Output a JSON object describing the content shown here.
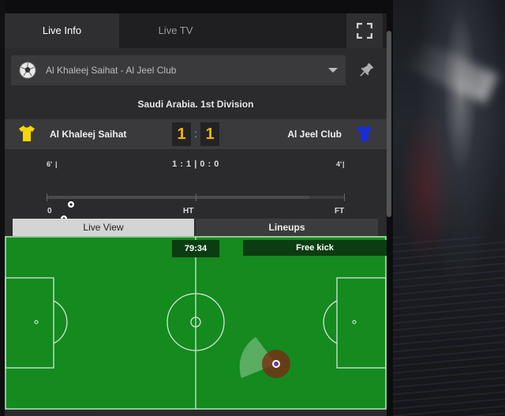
{
  "tabs": [
    {
      "label": "Live Info",
      "active": true
    },
    {
      "label": "Live TV",
      "active": false
    }
  ],
  "icons": {
    "fullscreen": "fullscreen-icon",
    "soccer_ball": "soccer-ball-icon",
    "pin": "pin-icon",
    "home_shirt": "shirt-icon",
    "away_shirt": "shirt-icon"
  },
  "match_select": {
    "value": "Al Khaleej Saihat - Al Jeel Club"
  },
  "league": "Saudi Arabia. 1st Division",
  "score": {
    "home_team": "Al Khaleej Saihat",
    "away_team": "Al Jeel Club",
    "home_goals": "1",
    "away_goals": "1",
    "separator": ":",
    "home_shirt_color": "#f5d800",
    "away_shirt_color": "#1a2bd8"
  },
  "timeline": {
    "home_goal_minute": "6'",
    "away_goal_minute": "4'",
    "summary": "1 : 1 | 0 : 0",
    "start_label": "0",
    "half_label": "HT",
    "full_label": "FT",
    "progress_fraction": 0.88
  },
  "view_tabs": {
    "live_view": "Live View",
    "lineups": "Lineups"
  },
  "pitch": {
    "clock": "79:34",
    "event": "Free kick",
    "pitch_color": "#148a1f"
  }
}
